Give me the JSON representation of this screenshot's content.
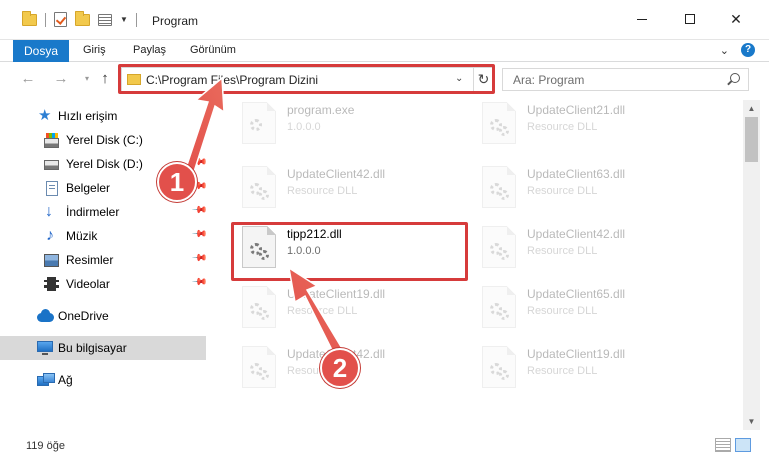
{
  "window": {
    "title": "Program"
  },
  "ribbon": {
    "tabs": [
      "Dosya",
      "Giriş",
      "Paylaş",
      "Görünüm"
    ]
  },
  "address_bar": {
    "path": "C:\\Program Files\\Program Dizini"
  },
  "search": {
    "placeholder": "Ara: Program"
  },
  "sidebar": {
    "items": [
      {
        "label": "Hızlı erişim",
        "icon": "star-icon",
        "pinned": false
      },
      {
        "label": "Yerel Disk (C:)",
        "icon": "drive-c-icon",
        "pinned": false
      },
      {
        "label": "Yerel Disk (D:)",
        "icon": "drive-d-icon",
        "pinned": true
      },
      {
        "label": "Belgeler",
        "icon": "documents-icon",
        "pinned": true
      },
      {
        "label": "İndirmeler",
        "icon": "downloads-icon",
        "pinned": true
      },
      {
        "label": "Müzik",
        "icon": "music-icon",
        "pinned": true
      },
      {
        "label": "Resimler",
        "icon": "pictures-icon",
        "pinned": true
      },
      {
        "label": "Videolar",
        "icon": "videos-icon",
        "pinned": true
      },
      {
        "label": "OneDrive",
        "icon": "onedrive-icon",
        "pinned": false
      },
      {
        "label": "Bu bilgisayar",
        "icon": "this-pc-icon",
        "pinned": false,
        "selected": true
      },
      {
        "label": "Ağ",
        "icon": "network-icon",
        "pinned": false
      }
    ]
  },
  "files": [
    {
      "name": "program.exe",
      "desc": "1.0.0.0",
      "highlighted": false
    },
    {
      "name": "UpdateClient21.dll",
      "desc": "Resource DLL",
      "highlighted": false
    },
    {
      "name": "UpdateClient42.dll",
      "desc": "Resource DLL",
      "highlighted": false
    },
    {
      "name": "UpdateClient63.dll",
      "desc": "Resource DLL",
      "highlighted": false
    },
    {
      "name": "tipp212.dll",
      "desc": "1.0.0.0",
      "highlighted": true
    },
    {
      "name": "UpdateClient42.dll",
      "desc": "Resource DLL",
      "highlighted": false
    },
    {
      "name": "UpdateClient19.dll",
      "desc": "Resource DLL",
      "highlighted": false
    },
    {
      "name": "UpdateClient65.dll",
      "desc": "Resource DLL",
      "highlighted": false
    },
    {
      "name": "UpdateClient42.dll",
      "desc": "Resource DLL",
      "highlighted": false
    },
    {
      "name": "UpdateClient19.dll",
      "desc": "Resource DLL",
      "highlighted": false
    }
  ],
  "status": {
    "item_count": "119 öğe"
  },
  "annotations": {
    "badge_1": "1",
    "badge_2": "2",
    "highlight_color": "#d63b3b",
    "badge_color": "#e2504b"
  }
}
